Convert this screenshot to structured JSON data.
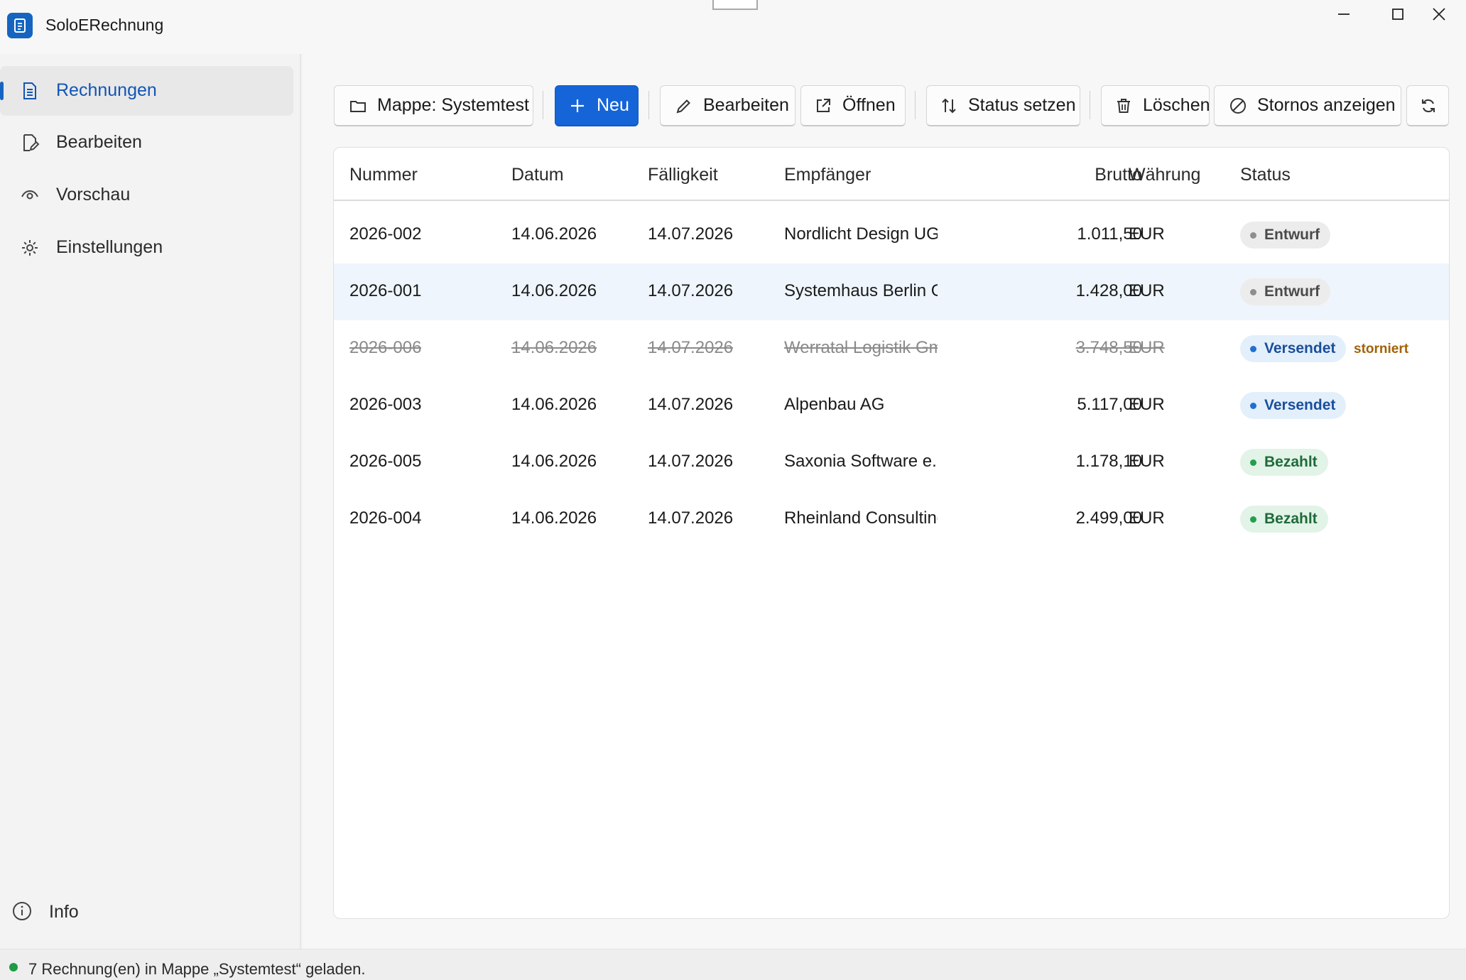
{
  "app": {
    "title": "SoloERechnung"
  },
  "sidebar": {
    "items": [
      {
        "label": "Rechnungen",
        "icon": "invoice-icon",
        "active": true
      },
      {
        "label": "Bearbeiten",
        "icon": "edit-document-icon",
        "active": false
      },
      {
        "label": "Vorschau",
        "icon": "eye-icon",
        "active": false
      },
      {
        "label": "Einstellungen",
        "icon": "gear-icon",
        "active": false
      }
    ],
    "info_label": "Info"
  },
  "toolbar": {
    "folder_label": "Mappe: Systemtest",
    "new_label": "Neu",
    "edit_label": "Bearbeiten",
    "open_label": "Öffnen",
    "status_label": "Status setzen",
    "delete_label": "Löschen",
    "stornos_label": "Stornos anzeigen"
  },
  "table": {
    "headers": {
      "number": "Nummer",
      "date": "Datum",
      "due": "Fälligkeit",
      "recipient": "Empfänger",
      "gross": "Brutto",
      "currency": "Währung",
      "status": "Status"
    },
    "rows": [
      {
        "number": "2026-002",
        "date": "14.06.2026",
        "due": "14.07.2026",
        "recipient": "Nordlicht Design UG",
        "gross": "1.011,50",
        "currency": "EUR",
        "status": "Entwurf",
        "status_kind": "draft",
        "storno": ""
      },
      {
        "number": "2026-001",
        "date": "14.06.2026",
        "due": "14.07.2026",
        "recipient": "Systemhaus Berlin GmbH",
        "gross": "1.428,00",
        "currency": "EUR",
        "status": "Entwurf",
        "status_kind": "draft",
        "storno": "",
        "selected": true
      },
      {
        "number": "2026-006",
        "date": "14.06.2026",
        "due": "14.07.2026",
        "recipient": "Werratal Logistik GmbH",
        "gross": "3.748,50",
        "currency": "EUR",
        "status": "Versendet",
        "status_kind": "sent",
        "storno": "storniert",
        "cancelled": true
      },
      {
        "number": "2026-003",
        "date": "14.06.2026",
        "due": "14.07.2026",
        "recipient": "Alpenbau AG",
        "gross": "5.117,00",
        "currency": "EUR",
        "status": "Versendet",
        "status_kind": "sent",
        "storno": ""
      },
      {
        "number": "2026-005",
        "date": "14.06.2026",
        "due": "14.07.2026",
        "recipient": "Saxonia Software e.K.",
        "gross": "1.178,10",
        "currency": "EUR",
        "status": "Bezahlt",
        "status_kind": "paid",
        "storno": ""
      },
      {
        "number": "2026-004",
        "date": "14.06.2026",
        "due": "14.07.2026",
        "recipient": "Rheinland Consulting",
        "gross": "2.499,00",
        "currency": "EUR",
        "status": "Bezahlt",
        "status_kind": "paid",
        "storno": ""
      }
    ]
  },
  "statusbar": {
    "text": "7 Rechnung(en) in Mappe „Systemtest“ geladen."
  },
  "colors": {
    "accent": "#1565d8",
    "draft": "#8e8e8e",
    "sent": "#2070d0",
    "paid": "#23a04c",
    "storno": "#a16207"
  }
}
